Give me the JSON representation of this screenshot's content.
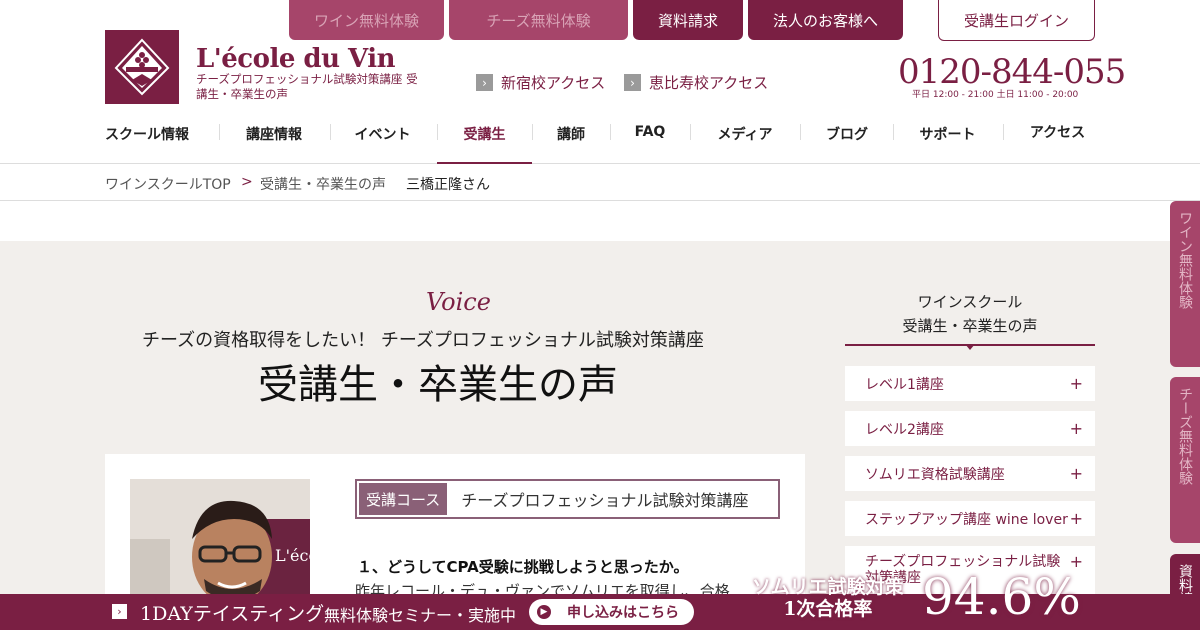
{
  "top_tabs": [
    {
      "label": "ワイン無料体験"
    },
    {
      "label": "チーズ無料体験"
    },
    {
      "label": "資料請求"
    },
    {
      "label": "法人のお客様へ"
    }
  ],
  "login_label": "受講生ログイン",
  "logo": {
    "title": "L'école du Vin",
    "subtitle": "チーズプロフェッショナル試験対策講座 受講生・卒業生の声"
  },
  "access_links": [
    {
      "label": "新宿校アクセス"
    },
    {
      "label": "恵比寿校アクセス"
    }
  ],
  "phone": "0120-844-055",
  "hours": "平日 12:00 - 21:00 土日 11:00 - 20:00",
  "nav": [
    {
      "label": "スクール情報"
    },
    {
      "label": "講座情報"
    },
    {
      "label": "イベント"
    },
    {
      "label": "受講生"
    },
    {
      "label": "講師"
    },
    {
      "label": "FAQ"
    },
    {
      "label": "メディア"
    },
    {
      "label": "ブログ"
    },
    {
      "label": "サポート"
    },
    {
      "label": "アクセス"
    }
  ],
  "breadcrumb": {
    "home": "ワインスクールTOP",
    "sep": ">",
    "parent": "受講生・卒業生の声",
    "current": "三橋正隆さん"
  },
  "hero": {
    "script": "Voice",
    "subtitle": "チーズの資格取得をしたい！ チーズプロフェッショナル試験対策講座",
    "title": "受講生・卒業生の声"
  },
  "card": {
    "course_tag": "受講コース",
    "course_name": "チーズプロフェッショナル試験対策講座",
    "question": "１、どうしてCPA受験に挑戦しようと思ったか。",
    "answer": "昨年レコール・デュ・ヴァンでソムリエを取得し、合格"
  },
  "sidebar": {
    "heading_line1": "ワインスクール",
    "heading_line2": "受講生・卒業生の声",
    "items": [
      {
        "label": "レベル1講座"
      },
      {
        "label": "レベル2講座"
      },
      {
        "label": "ソムリエ資格試験講座"
      },
      {
        "label": "ステップアップ講座 wine lover"
      },
      {
        "label": "チーズプロフェッショナル試験対策講座"
      }
    ]
  },
  "vertical_tabs": [
    {
      "label": "ワイン無料体験"
    },
    {
      "label": "チーズ無料体験"
    },
    {
      "label": "資料請"
    }
  ],
  "banner": {
    "title": "1DAYテイスティング",
    "text": "無料体験セミナー・実施中",
    "button": "申し込みはこちら",
    "rate_label_line1": "ソムリエ試験対策",
    "rate_label_line2": "1次合格率",
    "rate_value": "94.6%"
  }
}
